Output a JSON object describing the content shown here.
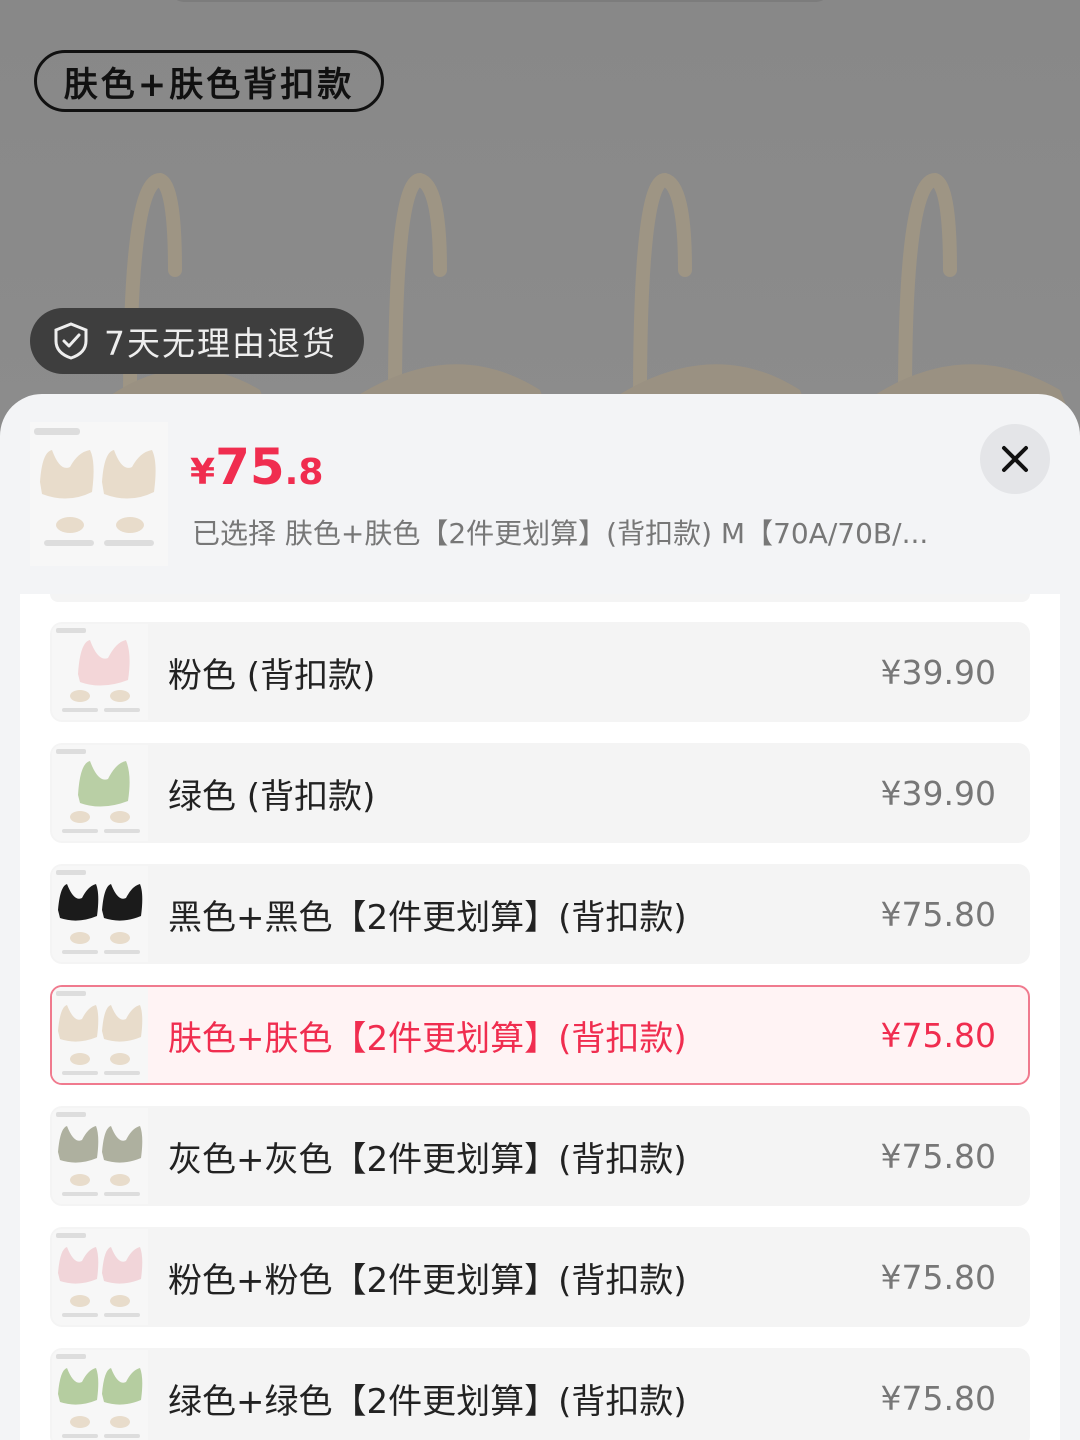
{
  "background": {
    "variant_tag": "肤色+肤色背扣款",
    "return_badge": "7天无理由退货"
  },
  "sheet": {
    "price": {
      "currency": "¥",
      "integer": "75",
      "decimal": ".8"
    },
    "selected_text": "已选择 肤色+肤色【2件更划算】(背扣款) M【70A/70B/...",
    "options": [
      {
        "label": "粉色 (背扣款)",
        "price": "¥39.90",
        "bra_color": "#f3d6d8",
        "selected": false
      },
      {
        "label": "绿色 (背扣款)",
        "price": "¥39.90",
        "bra_color": "#b9cfa5",
        "selected": false
      },
      {
        "label": "黑色+黑色【2件更划算】(背扣款)",
        "price": "¥75.80",
        "bra_color": "#1b1b1b",
        "selected": false
      },
      {
        "label": "肤色+肤色【2件更划算】(背扣款)",
        "price": "¥75.80",
        "bra_color": "#e8dccb",
        "selected": true
      },
      {
        "label": "灰色+灰色【2件更划算】(背扣款)",
        "price": "¥75.80",
        "bra_color": "#aeb09f",
        "selected": false
      },
      {
        "label": "粉色+粉色【2件更划算】(背扣款)",
        "price": "¥75.80",
        "bra_color": "#f1d5d9",
        "selected": false
      },
      {
        "label": "绿色+绿色【2件更划算】(背扣款)",
        "price": "¥75.80",
        "bra_color": "#b5cda0",
        "selected": false
      }
    ]
  },
  "colors": {
    "accent": "#f02d4f",
    "selected_border": "#f07a8e"
  }
}
